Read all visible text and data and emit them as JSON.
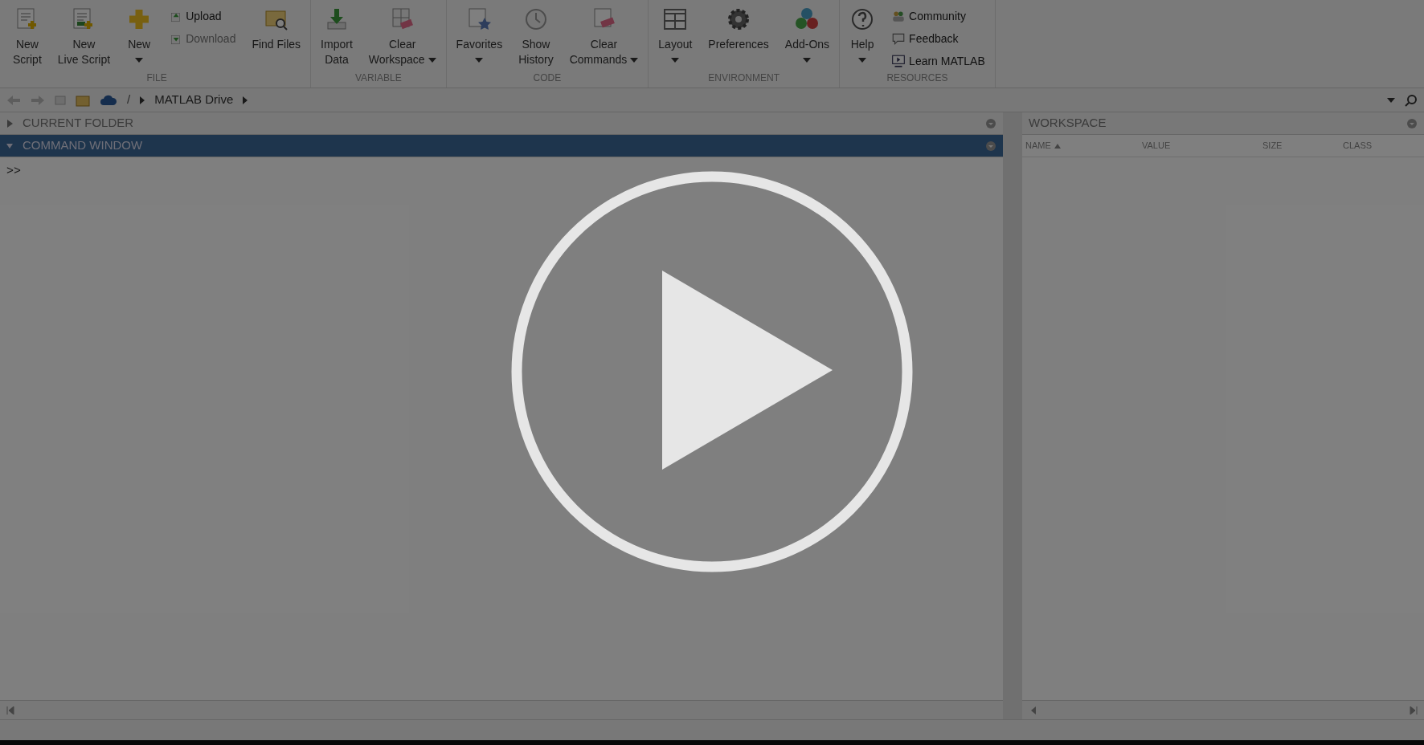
{
  "ribbon": {
    "groups": [
      {
        "label": "FILE",
        "items": [
          {
            "kind": "new-script",
            "lines": [
              "New",
              "Script"
            ],
            "dropdown": false
          },
          {
            "kind": "new-live-script",
            "lines": [
              "New",
              "Live Script"
            ],
            "dropdown": false
          },
          {
            "kind": "new",
            "lines": [
              "New"
            ],
            "dropdown": true
          },
          {
            "kind": "stack",
            "items": [
              {
                "kind": "upload",
                "label": "Upload",
                "disabled": false
              },
              {
                "kind": "download",
                "label": "Download",
                "disabled": true
              }
            ]
          },
          {
            "kind": "find-files",
            "lines": [
              "Find Files"
            ],
            "dropdown": false
          }
        ]
      },
      {
        "label": "VARIABLE",
        "items": [
          {
            "kind": "import",
            "lines": [
              "Import",
              "Data"
            ],
            "dropdown": false
          },
          {
            "kind": "clear-workspace",
            "lines": [
              "Clear",
              "Workspace"
            ],
            "dropdown": true
          }
        ]
      },
      {
        "label": "CODE",
        "items": [
          {
            "kind": "favorites",
            "lines": [
              "Favorites"
            ],
            "dropdown": true
          },
          {
            "kind": "history",
            "lines": [
              "Show",
              "History"
            ],
            "dropdown": false
          },
          {
            "kind": "clear-commands",
            "lines": [
              "Clear",
              "Commands"
            ],
            "dropdown": true
          }
        ]
      },
      {
        "label": "ENVIRONMENT",
        "items": [
          {
            "kind": "layout",
            "lines": [
              "Layout"
            ],
            "dropdown": true
          },
          {
            "kind": "preferences",
            "lines": [
              "Preferences"
            ],
            "dropdown": false
          },
          {
            "kind": "add-ons",
            "lines": [
              "Add-Ons"
            ],
            "dropdown": true
          }
        ]
      },
      {
        "label": "RESOURCES",
        "items": [
          {
            "kind": "help",
            "lines": [
              "Help"
            ],
            "dropdown": true
          },
          {
            "kind": "stack",
            "items": [
              {
                "kind": "community",
                "label": "Community",
                "disabled": false
              },
              {
                "kind": "feedback",
                "label": "Feedback",
                "disabled": false
              },
              {
                "kind": "learn",
                "label": "Learn MATLAB",
                "disabled": false
              }
            ]
          }
        ]
      }
    ]
  },
  "address_bar": {
    "root": "/",
    "crumbs": [
      "MATLAB Drive"
    ]
  },
  "left_panels": [
    {
      "title": "CURRENT FOLDER",
      "expanded": false,
      "selected": false
    },
    {
      "title": "COMMAND WINDOW",
      "expanded": true,
      "selected": true
    }
  ],
  "command_window": {
    "prompt": ">>"
  },
  "workspace": {
    "title": "WORKSPACE",
    "columns": [
      {
        "label": "NAME",
        "sorted": true
      },
      {
        "label": "VALUE",
        "sorted": false
      },
      {
        "label": "SIZE",
        "sorted": false
      },
      {
        "label": "CLASS",
        "sorted": false
      }
    ]
  },
  "video_overlay": {
    "kind": "play"
  }
}
